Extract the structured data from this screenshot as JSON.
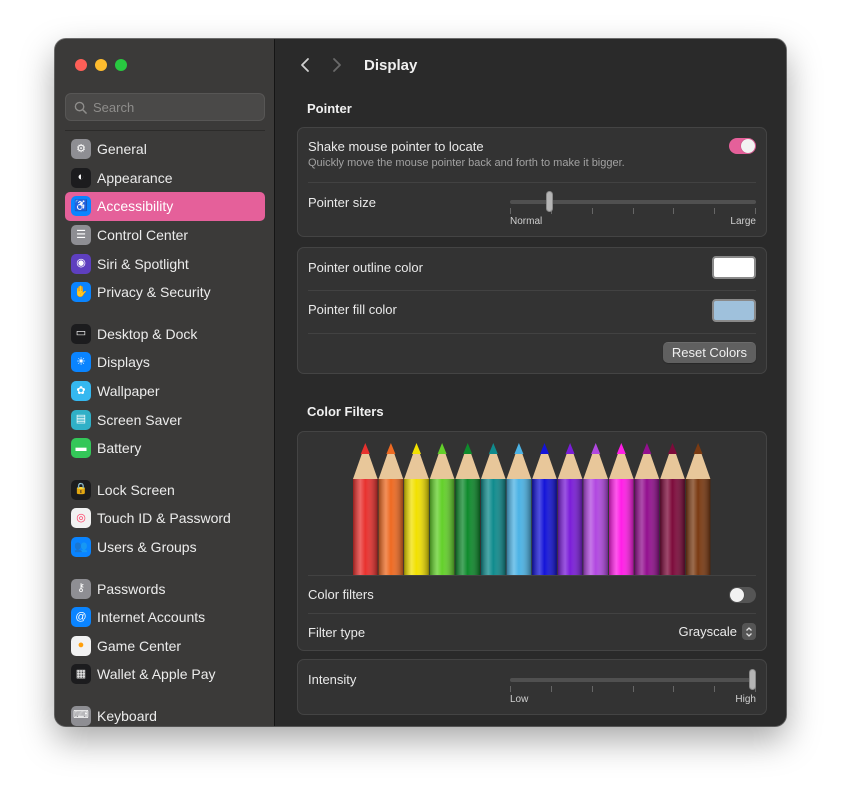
{
  "window": {
    "controls": [
      "close",
      "minimize",
      "zoom"
    ]
  },
  "search": {
    "placeholder": "Search",
    "value": ""
  },
  "sidebar": {
    "groups": [
      [
        {
          "id": "general",
          "label": "General",
          "icon": "gear-icon",
          "color": "#8e8e93",
          "glyph": "⚙"
        },
        {
          "id": "appearance",
          "label": "Appearance",
          "icon": "appearance-icon",
          "color": "#1c1c1e",
          "glyph": "◐"
        },
        {
          "id": "accessibility",
          "label": "Accessibility",
          "icon": "accessibility-icon",
          "color": "#0a84ff",
          "glyph": "♿",
          "active": true
        },
        {
          "id": "control-center",
          "label": "Control Center",
          "icon": "control-center-icon",
          "color": "#8e8e93",
          "glyph": "☰"
        },
        {
          "id": "siri-spotlight",
          "label": "Siri & Spotlight",
          "icon": "siri-icon",
          "color": "#5e3fbf",
          "glyph": "◉"
        },
        {
          "id": "privacy-security",
          "label": "Privacy & Security",
          "icon": "hand-icon",
          "color": "#0a84ff",
          "glyph": "✋"
        }
      ],
      [
        {
          "id": "desktop-dock",
          "label": "Desktop & Dock",
          "icon": "dock-icon",
          "color": "#1c1c1e",
          "glyph": "▭"
        },
        {
          "id": "displays",
          "label": "Displays",
          "icon": "sun-icon",
          "color": "#0a84ff",
          "glyph": "☀"
        },
        {
          "id": "wallpaper",
          "label": "Wallpaper",
          "icon": "flower-icon",
          "color": "#35b8f0",
          "glyph": "✿"
        },
        {
          "id": "screen-saver",
          "label": "Screen Saver",
          "icon": "screen-saver-icon",
          "color": "#30b0c7",
          "glyph": "▤"
        },
        {
          "id": "battery",
          "label": "Battery",
          "icon": "battery-icon",
          "color": "#34c759",
          "glyph": "▬"
        }
      ],
      [
        {
          "id": "lock-screen",
          "label": "Lock Screen",
          "icon": "lock-icon",
          "color": "#1c1c1e",
          "glyph": "🔒"
        },
        {
          "id": "touch-id",
          "label": "Touch ID & Password",
          "icon": "fingerprint-icon",
          "color": "#f2f2f2",
          "glyph": "◎",
          "glyph_color": "#ff375f"
        },
        {
          "id": "users-groups",
          "label": "Users & Groups",
          "icon": "users-icon",
          "color": "#0a84ff",
          "glyph": "👥"
        }
      ],
      [
        {
          "id": "passwords",
          "label": "Passwords",
          "icon": "key-icon",
          "color": "#8e8e93",
          "glyph": "⚷"
        },
        {
          "id": "internet-accounts",
          "label": "Internet Accounts",
          "icon": "at-icon",
          "color": "#0a84ff",
          "glyph": "@"
        },
        {
          "id": "game-center",
          "label": "Game Center",
          "icon": "game-center-icon",
          "color": "#f2f2f2",
          "glyph": "●",
          "glyph_color": "#ff9f0a"
        },
        {
          "id": "wallet",
          "label": "Wallet & Apple Pay",
          "icon": "wallet-icon",
          "color": "#1c1c1e",
          "glyph": "▦"
        }
      ],
      [
        {
          "id": "keyboard",
          "label": "Keyboard",
          "icon": "keyboard-icon",
          "color": "#8e8e93",
          "glyph": "⌨"
        }
      ]
    ]
  },
  "toolbar": {
    "title": "Display"
  },
  "pointer": {
    "section_title": "Pointer",
    "shake": {
      "label": "Shake mouse pointer to locate",
      "description": "Quickly move the mouse pointer back and forth to make it bigger.",
      "enabled": true
    },
    "size": {
      "label": "Pointer size",
      "min_label": "Normal",
      "max_label": "Large",
      "value": 0.15,
      "ticks": 7
    },
    "outline": {
      "label": "Pointer outline color",
      "color": "#ffffff"
    },
    "fill": {
      "label": "Pointer fill color",
      "color": "#9fc1dc"
    },
    "reset_label": "Reset Colors"
  },
  "color_filters": {
    "section_title": "Color Filters",
    "pencils": [
      "#e8312e",
      "#ee6a22",
      "#f2e100",
      "#63d02a",
      "#0e8a2c",
      "#0f8b8d",
      "#4cb3e5",
      "#1414d8",
      "#7a1dd8",
      "#b148e0",
      "#ff1ee6",
      "#93108f",
      "#7d0b3b",
      "#7a3a12"
    ],
    "filters": {
      "label": "Color filters",
      "enabled": false
    },
    "type": {
      "label": "Filter type",
      "value": "Grayscale"
    },
    "intensity": {
      "label": "Intensity",
      "min_label": "Low",
      "max_label": "High",
      "value": 1.0,
      "ticks": 7
    }
  },
  "colors": {
    "accent": "#e5609a",
    "toggle_on": "#e5609a",
    "toggle_off": "#555555"
  }
}
